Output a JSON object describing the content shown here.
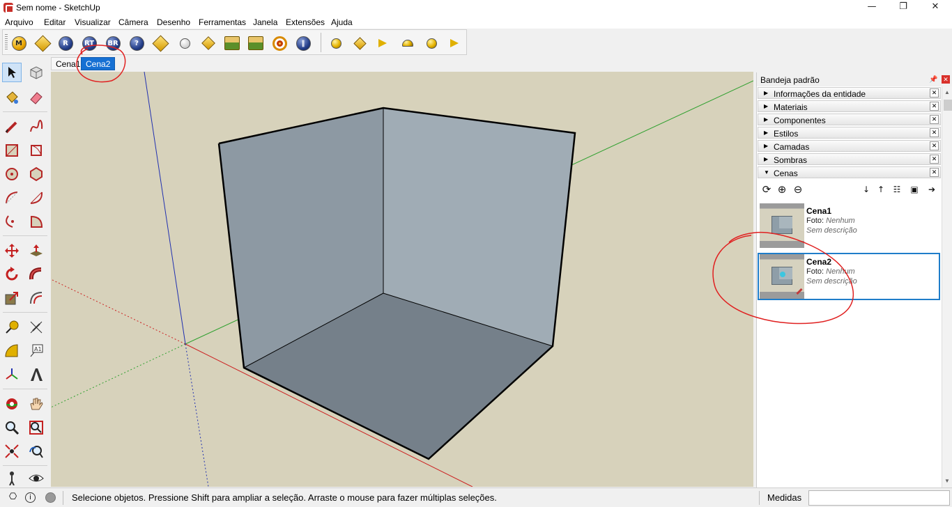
{
  "window": {
    "title": "Sem nome - SketchUp",
    "minimize": "—",
    "restore": "❐",
    "close": "✕"
  },
  "menu": [
    "Arquivo",
    "Editar",
    "Visualizar",
    "Câmera",
    "Desenho",
    "Ferramentas",
    "Janela",
    "Extensões",
    "Ajuda"
  ],
  "toolbar": {
    "ball_labels": {
      "m": "M",
      "r": "R",
      "rt": "RT",
      "br": "BR",
      "help": "?"
    }
  },
  "scene_tabs": [
    {
      "label": "Cena1",
      "active": false
    },
    {
      "label": "Cena2",
      "active": true
    }
  ],
  "tray": {
    "title": "Bandeja padrão",
    "panels": [
      {
        "label": "Informações da entidade",
        "expanded": false
      },
      {
        "label": "Materiais",
        "expanded": false
      },
      {
        "label": "Componentes",
        "expanded": false
      },
      {
        "label": "Estilos",
        "expanded": false
      },
      {
        "label": "Camadas",
        "expanded": false
      },
      {
        "label": "Sombras",
        "expanded": false
      },
      {
        "label": "Cenas",
        "expanded": true
      }
    ],
    "scenes": [
      {
        "name": "Cena1",
        "foto_label": "Foto:",
        "foto_value": "Nenhum",
        "description": "Sem descrição",
        "selected": false
      },
      {
        "name": "Cena2",
        "foto_label": "Foto:",
        "foto_value": "Nenhum",
        "description": "Sem descrição",
        "selected": true
      }
    ]
  },
  "status": {
    "message": "Selecione objetos. Pressione Shift para ampliar a seleção. Arraste o mouse para fazer múltiplas seleções.",
    "measure_label": "Medidas",
    "measure_value": ""
  },
  "colors": {
    "viewport_bg": "#d7d2bb",
    "active_tab": "#1670d3",
    "annotation": "#e02020",
    "axis_red": "#cc2020",
    "axis_green": "#20a020",
    "axis_blue": "#2030b0"
  }
}
